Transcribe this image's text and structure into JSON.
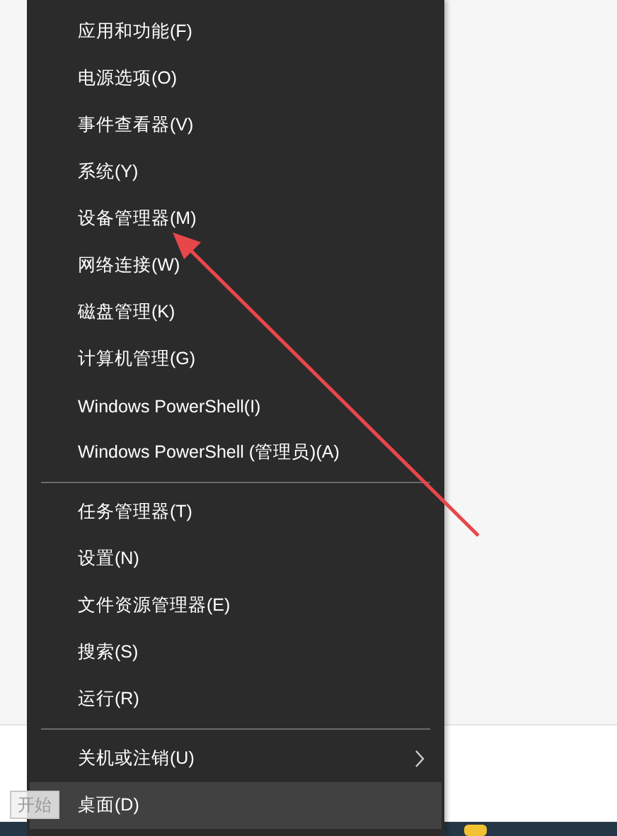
{
  "menu": {
    "groups": [
      {
        "items": [
          {
            "label": "应用和功能(F)",
            "selected": false
          },
          {
            "label": "电源选项(O)",
            "selected": false
          },
          {
            "label": "事件查看器(V)",
            "selected": false
          },
          {
            "label": "系统(Y)",
            "selected": false
          },
          {
            "label": "设备管理器(M)",
            "selected": false
          },
          {
            "label": "网络连接(W)",
            "selected": false
          },
          {
            "label": "磁盘管理(K)",
            "selected": false
          },
          {
            "label": "计算机管理(G)",
            "selected": false
          },
          {
            "label": "Windows PowerShell(I)",
            "selected": false
          },
          {
            "label": "Windows PowerShell (管理员)(A)",
            "selected": false
          }
        ]
      },
      {
        "items": [
          {
            "label": "任务管理器(T)",
            "selected": false
          },
          {
            "label": "设置(N)",
            "selected": false
          },
          {
            "label": "文件资源管理器(E)",
            "selected": false
          },
          {
            "label": "搜索(S)",
            "selected": false
          },
          {
            "label": "运行(R)",
            "selected": false
          }
        ]
      },
      {
        "items": [
          {
            "label": "关机或注销(U)",
            "selected": false,
            "submenu": true
          },
          {
            "label": "桌面(D)",
            "selected": true
          }
        ]
      }
    ]
  },
  "tooltip": "开始"
}
